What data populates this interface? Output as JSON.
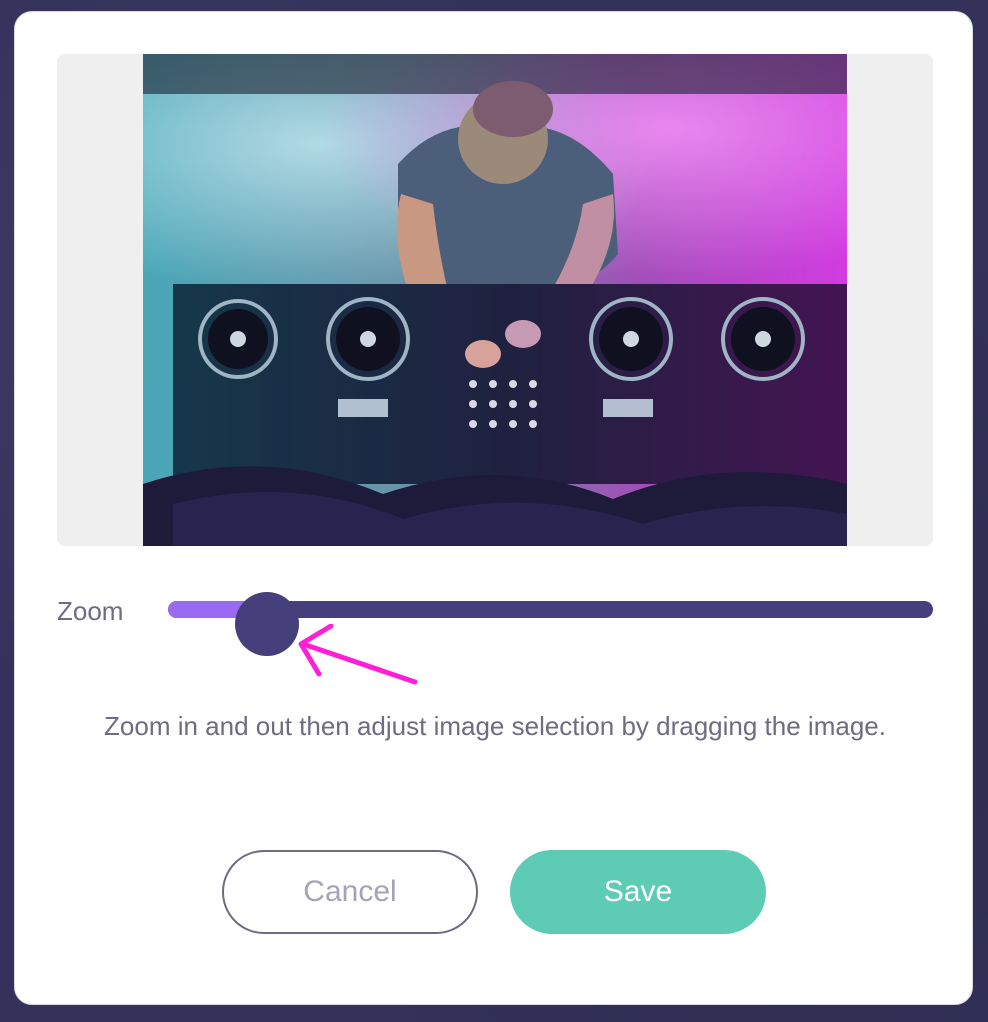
{
  "dialog": {
    "zoom": {
      "label": "Zoom",
      "value_fraction": 0.13
    },
    "help_text": "Zoom in and out then adjust image selection by dragging the image.",
    "buttons": {
      "cancel_label": "Cancel",
      "save_label": "Save"
    }
  },
  "colors": {
    "slider_track": "#45407c",
    "slider_fill": "#9a6bf2",
    "save_button": "#5ecbb5",
    "annotation_arrow": "#ff1fd6"
  },
  "annotation": {
    "icon": "arrow-pointer-icon"
  }
}
